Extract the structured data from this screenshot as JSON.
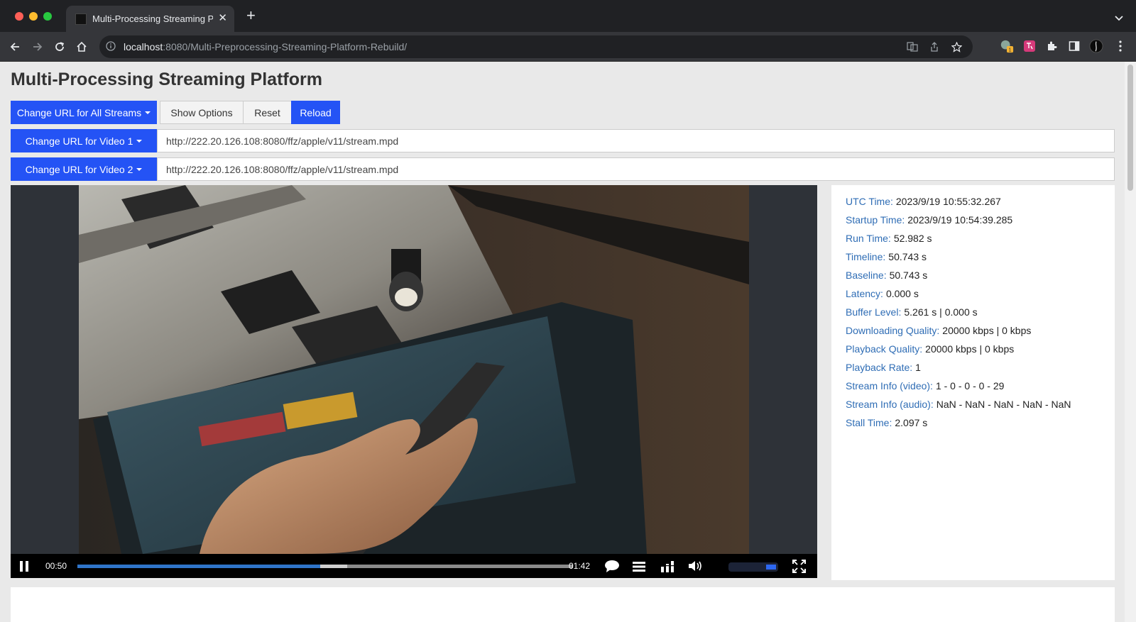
{
  "browser": {
    "tab_title": "Multi-Processing Streaming Pla",
    "url_host": "localhost",
    "url_rest": ":8080/Multi-Preprocessing-Streaming-Platform-Rebuild/",
    "ext_badge": "1"
  },
  "page": {
    "title": "Multi-Processing Streaming Platform"
  },
  "toolbar": {
    "change_all_label": "Change URL for All Streams",
    "show_options_label": "Show Options",
    "reset_label": "Reset",
    "reload_label": "Reload"
  },
  "streams": [
    {
      "button_label": "Change URL for Video 1",
      "url": "http://222.20.126.108:8080/ffz/apple/v11/stream.mpd"
    },
    {
      "button_label": "Change URL for Video 2",
      "url": "http://222.20.126.108:8080/ffz/apple/v11/stream.mpd"
    }
  ],
  "player": {
    "current_time": "00:50",
    "duration": "01:42",
    "progress_fraction": 0.49,
    "buffered_fraction": 0.545,
    "volume_fraction": 1.0
  },
  "stats": [
    {
      "label": "UTC Time:",
      "value": "2023/9/19 10:55:32.267"
    },
    {
      "label": "Startup Time:",
      "value": "2023/9/19 10:54:39.285"
    },
    {
      "label": "Run Time:",
      "value": "52.982 s"
    },
    {
      "label": "Timeline:",
      "value": "50.743 s"
    },
    {
      "label": "Baseline:",
      "value": "50.743 s"
    },
    {
      "label": "Latency:",
      "value": "0.000 s"
    },
    {
      "label": "Buffer Level:",
      "value": "5.261 s | 0.000 s"
    },
    {
      "label": "Downloading Quality:",
      "value": "20000 kbps | 0 kbps"
    },
    {
      "label": "Playback Quality:",
      "value": "20000 kbps | 0 kbps"
    },
    {
      "label": "Playback Rate:",
      "value": "1"
    },
    {
      "label": "Stream Info (video):",
      "value": "1 - 0 - 0 - 0 - 29"
    },
    {
      "label": "Stream Info (audio):",
      "value": "NaN - NaN - NaN - NaN - NaN"
    },
    {
      "label": "Stall Time:",
      "value": "2.097 s"
    }
  ],
  "colors": {
    "primary": "#2453f5",
    "stat_label": "#2f6db5",
    "page_bg": "#e9e9e9"
  }
}
